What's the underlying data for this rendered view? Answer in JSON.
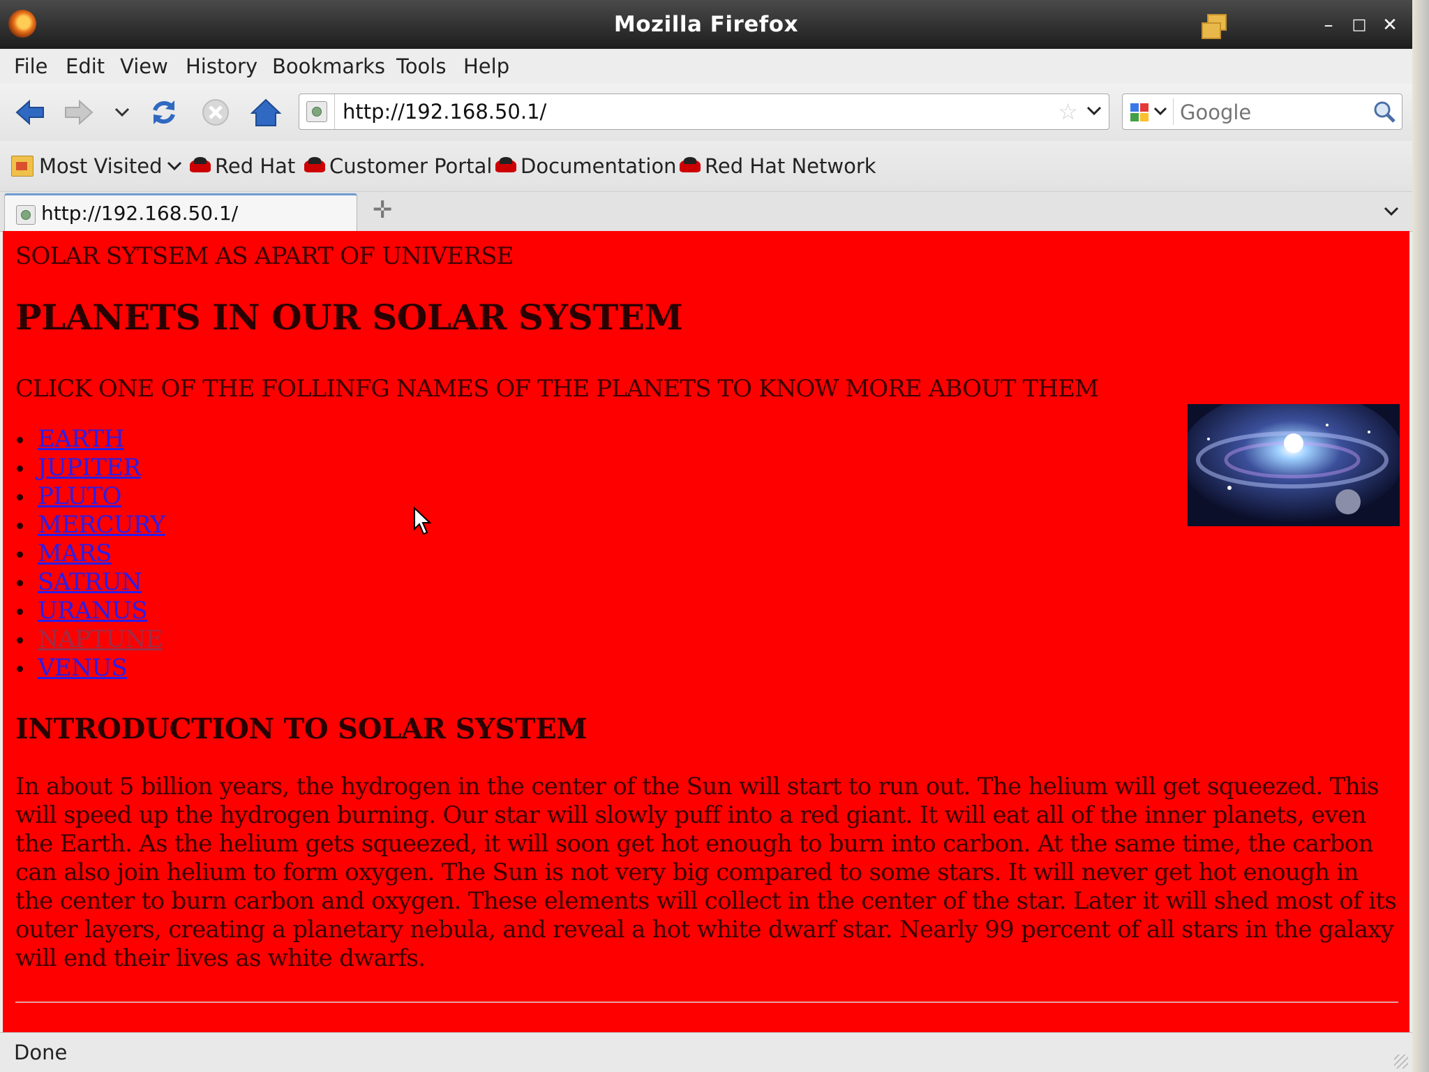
{
  "window": {
    "title": "Mozilla Firefox"
  },
  "menu": {
    "items": [
      "File",
      "Edit",
      "View",
      "History",
      "Bookmarks",
      "Tools",
      "Help"
    ]
  },
  "navigation": {
    "url": "http://192.168.50.1/",
    "search_placeholder": "Google"
  },
  "bookmarks": {
    "most_visited": "Most Visited",
    "items": [
      "Red Hat",
      "Customer Portal",
      "Documentation",
      "Red Hat Network"
    ]
  },
  "tabs": [
    {
      "label": "http://192.168.50.1/"
    }
  ],
  "page": {
    "intro": "SOLAR SYTSEM AS APART OF UNIVERSE",
    "heading": "PLANETS IN OUR SOLAR SYSTEM",
    "instruction": "CLICK ONE OF THE FOLLINFG NAMES OF THE PLANETS TO KNOW MORE ABOUT THEM",
    "planets": [
      "EARTH",
      "JUPITER",
      "PLUTO",
      "MERCURY",
      "MARS",
      "SATRUN",
      "URANUS",
      "NAPTUNE",
      "VENUS"
    ],
    "intro_heading": "INTRODUCTION TO SOLAR SYSTEM",
    "paragraph": "In about 5 billion years, the hydrogen in the center of the Sun will start to run out. The helium will get squeezed. This will speed up the hydrogen burning. Our star will slowly puff into a red giant. It will eat all of the inner planets, even the Earth. As the helium gets squeezed, it will soon get hot enough to burn into carbon. At the same time, the carbon can also join helium to form oxygen. The Sun is not very big compared to some stars. It will never get hot enough in the center to burn carbon and oxygen. These elements will collect in the center of the star. Later it will shed most of its outer layers, creating a planetary nebula, and reveal a hot white dwarf star. Nearly 99 percent of all stars in the galaxy will end their lives as white dwarfs."
  },
  "status": {
    "text": "Done"
  },
  "colors": {
    "page_background": "#ff0000",
    "link": "#2a1ee8",
    "visited_link": "#9b2e48"
  }
}
